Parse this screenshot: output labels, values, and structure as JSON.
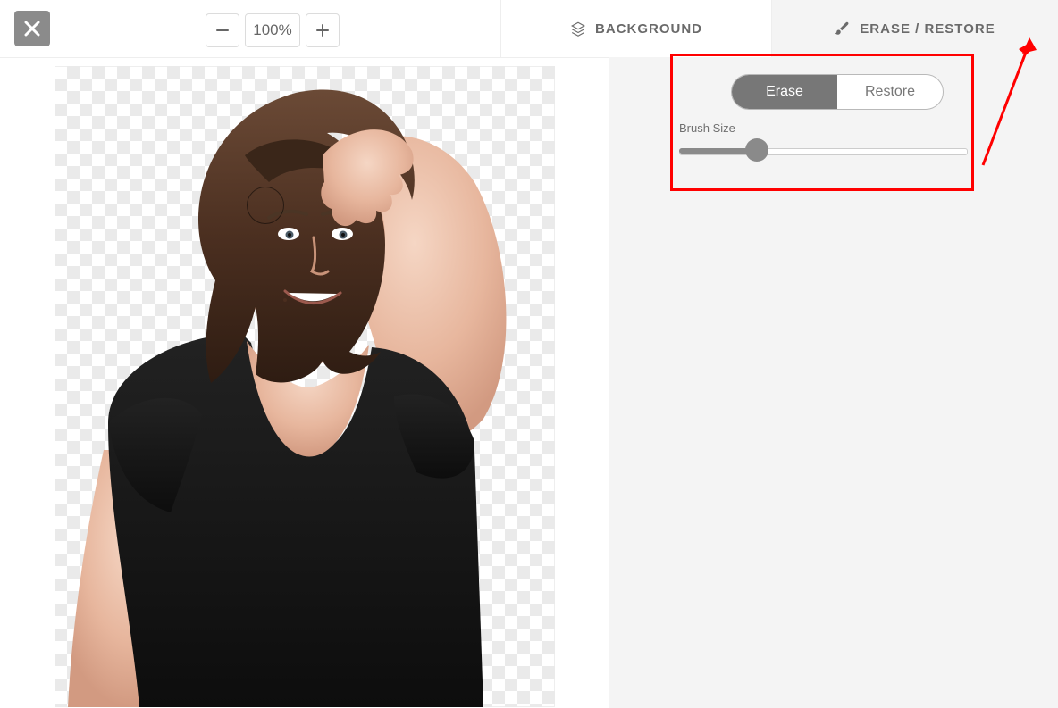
{
  "toolbar": {
    "close_icon": "close",
    "zoom_out_icon": "minus",
    "zoom_level": "100%",
    "zoom_in_icon": "plus",
    "undo_icon": "undo",
    "redo_icon": "redo"
  },
  "tabs": {
    "background": {
      "label": "BACKGROUND",
      "icon": "layers-icon",
      "active": false
    },
    "erase_restore": {
      "label": "ERASE / RESTORE",
      "icon": "brush-icon",
      "active": true
    }
  },
  "erase_panel": {
    "mode_erase_label": "Erase",
    "mode_restore_label": "Restore",
    "active_mode": "erase",
    "brush_size_label": "Brush Size",
    "brush_size_percent": 27
  },
  "annotation": {
    "highlight_box": true,
    "arrow_color": "#ff0000"
  },
  "canvas": {
    "subject_description": "woman-portrait-cutout",
    "brush_cursor_visible": true
  }
}
